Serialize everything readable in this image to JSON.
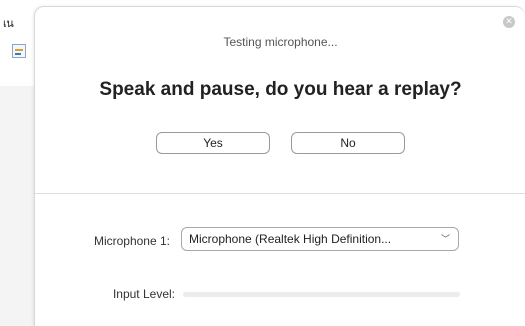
{
  "background": {
    "text": "เน"
  },
  "dialog": {
    "testing_text": "Testing microphone...",
    "question": "Speak and pause, do you hear a replay?",
    "yes_label": "Yes",
    "no_label": "No",
    "microphone_label": "Microphone 1:",
    "microphone_value": "Microphone (Realtek High Definition...",
    "input_level_label": "Input Level:",
    "input_level": 0,
    "close_icon": "close-icon"
  },
  "colors": {
    "border": "#9a9a9a",
    "divider": "#dedede",
    "level_track": "#ececec"
  }
}
